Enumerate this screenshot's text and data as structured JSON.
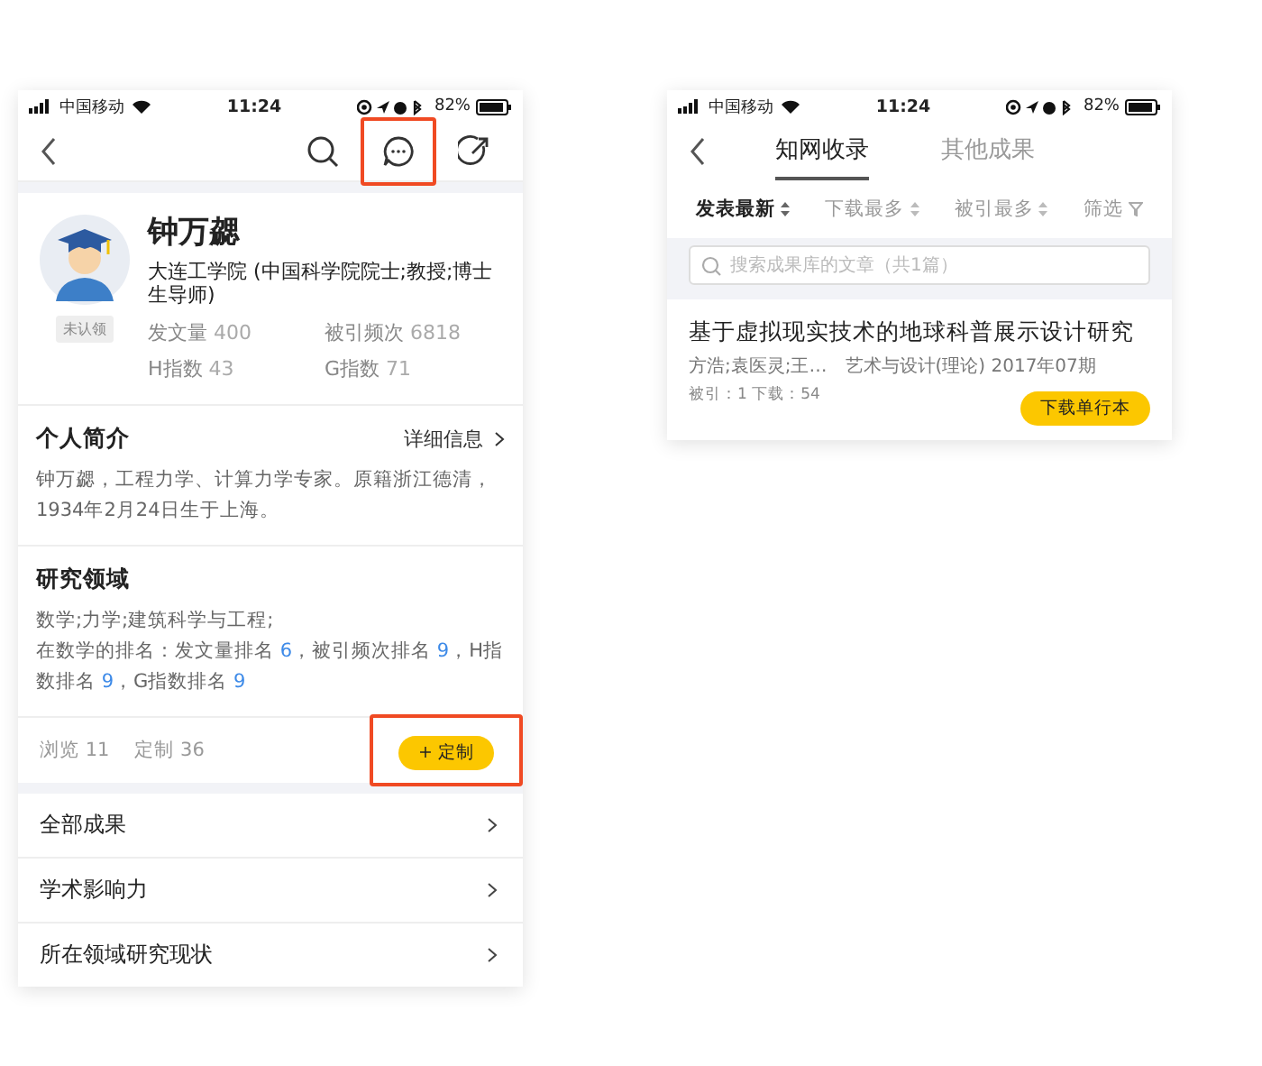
{
  "left_screen": {
    "status_bar": {
      "carrier": "中国移动",
      "time": "11:24",
      "battery": "82%"
    },
    "toolbar_icons": [
      {
        "kind": "search",
        "highlighted": false
      },
      {
        "kind": "message",
        "highlighted": true
      },
      {
        "kind": "share",
        "highlighted": false
      }
    ],
    "profile": {
      "name": "钟万勰",
      "affiliation": "大连工学院 (中国科学院院士;教授;博士生导师)",
      "badge": "未认领",
      "stats": [
        {
          "label": "发文量",
          "value": "400"
        },
        {
          "label": "被引频次",
          "value": "6818"
        },
        {
          "label": "H指数",
          "value": "43"
        },
        {
          "label": "G指数",
          "value": "71"
        }
      ]
    },
    "intro": {
      "title": "个人简介",
      "link": "详细信息",
      "text": "钟万勰，工程力学、计算力学专家。原籍浙江德清，1934年2月24日生于上海。"
    },
    "research": {
      "title": "研究领域",
      "fields": "数学;力学;建筑科学与工程;",
      "ranking": [
        {
          "kind": "plain",
          "text": "在数学的排名：发文量排名 "
        },
        {
          "kind": "number",
          "text": "6"
        },
        {
          "kind": "plain",
          "text": "，被引频次排名 "
        },
        {
          "kind": "number",
          "text": "9"
        },
        {
          "kind": "plain",
          "text": "，H指数排名 "
        },
        {
          "kind": "number",
          "text": "9"
        },
        {
          "kind": "plain",
          "text": "，G指数排名 "
        },
        {
          "kind": "number",
          "text": "9"
        }
      ]
    },
    "footer": {
      "views": "浏览 11",
      "subscriptions": "定制 36",
      "button": {
        "label": "+ 定制",
        "highlighted": true
      }
    },
    "menu": [
      "全部成果",
      "学术影响力",
      "所在领域研究现状"
    ]
  },
  "right_screen": {
    "status_bar": {
      "carrier": "中国移动",
      "time": "11:24",
      "battery": "82%"
    },
    "tabs": [
      {
        "label": "知网收录",
        "selected": true
      },
      {
        "label": "其他成果",
        "selected": false
      }
    ],
    "sort_options": [
      {
        "kind": "sort",
        "label": "发表最新",
        "selected": true
      },
      {
        "kind": "sort",
        "label": "下载最多",
        "selected": false
      },
      {
        "kind": "sort",
        "label": "被引最多",
        "selected": false
      },
      {
        "kind": "filter",
        "label": "筛选",
        "selected": false
      }
    ],
    "search": {
      "placeholder": "搜索成果库的文章（共1篇）"
    },
    "article": {
      "title": "基于虚拟现实技术的地球科普展示设计研究",
      "authors": "方浩;袁医灵;王…",
      "journal": "艺术与设计(理论) 2017年07期",
      "counts": "被引：1 下载：54",
      "button": "下载单行本"
    }
  }
}
